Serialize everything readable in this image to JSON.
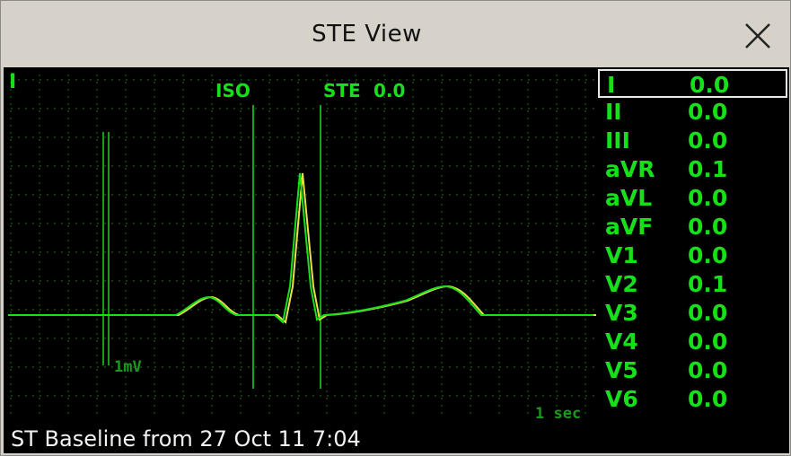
{
  "window": {
    "title": "STE View",
    "close_icon": "close-icon"
  },
  "waveform": {
    "lead_label": "I",
    "iso_label": "ISO",
    "ste_label": "STE",
    "ste_value": "0.0",
    "calibration_label": "1mV",
    "time_scale_label": "1 sec",
    "grid_color": "#1a6e1a",
    "trace_color": "#17e01a",
    "baseline_trace_color": "#e8e048"
  },
  "leads": [
    {
      "name": "I",
      "value": "0.0",
      "selected": true
    },
    {
      "name": "II",
      "value": "0.0"
    },
    {
      "name": "III",
      "value": "0.0"
    },
    {
      "name": "aVR",
      "value": "0.1"
    },
    {
      "name": "aVL",
      "value": "0.0"
    },
    {
      "name": "aVF",
      "value": "0.0"
    },
    {
      "name": "V1",
      "value": "0.0"
    },
    {
      "name": "V2",
      "value": "0.1"
    },
    {
      "name": "V3",
      "value": "0.0"
    },
    {
      "name": "V4",
      "value": "0.0"
    },
    {
      "name": "V5",
      "value": "0.0"
    },
    {
      "name": "V6",
      "value": "0.0"
    }
  ],
  "footer": {
    "baseline_text": "ST  Baseline  from  27  Oct  11  7:04"
  }
}
